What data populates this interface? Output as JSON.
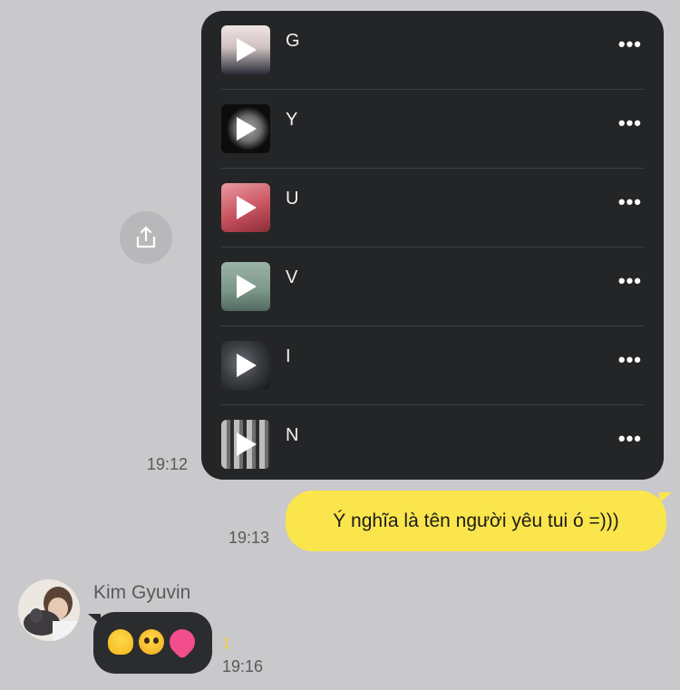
{
  "share": {
    "icon": "share-icon"
  },
  "playlist": {
    "tracks": [
      {
        "title": "G",
        "thumb_color": "#d9c9c7",
        "more": "•••"
      },
      {
        "title": "Y",
        "thumb_color": "#101010",
        "more": "•••"
      },
      {
        "title": "U",
        "thumb_color": "#d7737c",
        "more": "•••"
      },
      {
        "title": "V",
        "thumb_color": "#7f9c8f",
        "more": "•••"
      },
      {
        "title": "I",
        "thumb_color": "#3d3f44",
        "more": "•••"
      },
      {
        "title": "N",
        "thumb_color": "#8b8b8b",
        "more": "•••"
      }
    ],
    "time": "19:12"
  },
  "outgoing": {
    "text": "Ý nghĩa là tên người yêu tui ó =)))",
    "time": "19:13",
    "bubble_color": "#fbe54d"
  },
  "incoming": {
    "sender": "Kim Gyuvin",
    "emojis": [
      "melting-face",
      "pleading-face",
      "sparkling-heart"
    ],
    "unread": "1",
    "time": "19:16"
  }
}
